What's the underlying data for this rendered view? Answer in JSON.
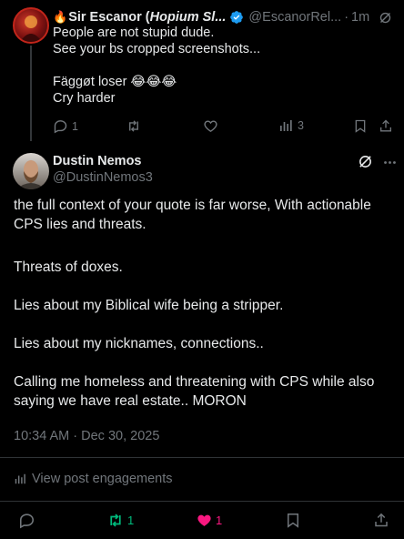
{
  "reply": {
    "name_prefix": "Sir Escanor (",
    "name_italic": "Hopium Sl...",
    "handle": "@EscanorRel...",
    "separator": "·",
    "time": "1m",
    "lines": [
      "People are not stupid dude.",
      "See your bs cropped screenshots...",
      "",
      "Fäggøt loser 😂😂😂",
      "Cry harder"
    ],
    "replies": "1",
    "views": "3"
  },
  "post": {
    "name": "Dustin Nemos",
    "handle": "@DustinNemos3",
    "paragraphs": [
      "the full context of your quote is far worse, With actionable CPS lies and threats.",
      "Threats of doxes.",
      "Lies about my Biblical wife being a stripper.",
      "Lies about my nicknames, connections..",
      "Calling me homeless and threatening with CPS while also saying we have real estate.. MORON"
    ],
    "timestamp": "10:34 AM · Dec 30, 2025",
    "engagements_label": "View post engagements",
    "reposts": "1",
    "likes": "1"
  },
  "colors": {
    "background": "#000000",
    "text": "#e7e9ea",
    "muted": "#71767b",
    "repost_green": "#00ba7c",
    "like_pink": "#f91880",
    "verified_blue": "#1d9bf0"
  }
}
